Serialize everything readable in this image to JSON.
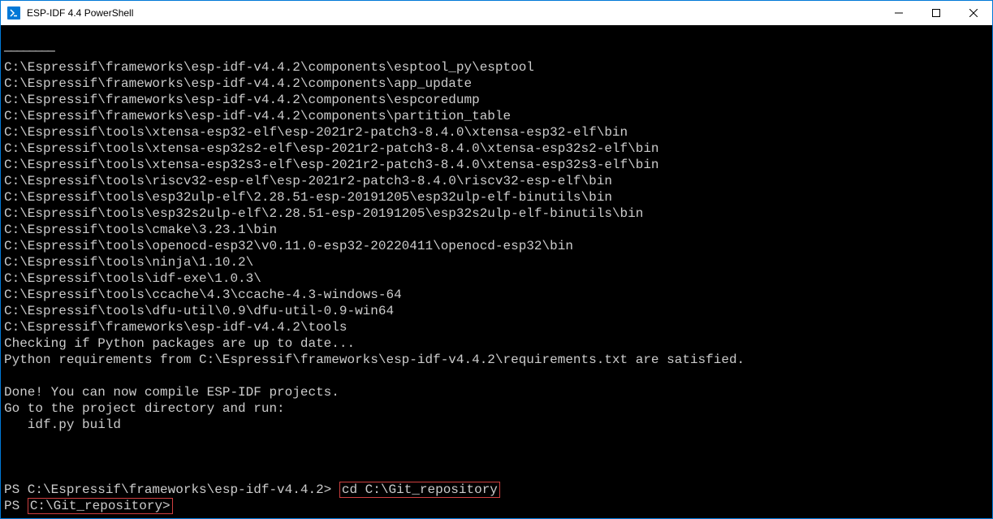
{
  "window": {
    "title": "ESP-IDF 4.4 PowerShell"
  },
  "terminal": {
    "separator": "————————",
    "paths": [
      "C:\\Espressif\\frameworks\\esp-idf-v4.4.2\\components\\esptool_py\\esptool",
      "C:\\Espressif\\frameworks\\esp-idf-v4.4.2\\components\\app_update",
      "C:\\Espressif\\frameworks\\esp-idf-v4.4.2\\components\\espcoredump",
      "C:\\Espressif\\frameworks\\esp-idf-v4.4.2\\components\\partition_table",
      "C:\\Espressif\\tools\\xtensa-esp32-elf\\esp-2021r2-patch3-8.4.0\\xtensa-esp32-elf\\bin",
      "C:\\Espressif\\tools\\xtensa-esp32s2-elf\\esp-2021r2-patch3-8.4.0\\xtensa-esp32s2-elf\\bin",
      "C:\\Espressif\\tools\\xtensa-esp32s3-elf\\esp-2021r2-patch3-8.4.0\\xtensa-esp32s3-elf\\bin",
      "C:\\Espressif\\tools\\riscv32-esp-elf\\esp-2021r2-patch3-8.4.0\\riscv32-esp-elf\\bin",
      "C:\\Espressif\\tools\\esp32ulp-elf\\2.28.51-esp-20191205\\esp32ulp-elf-binutils\\bin",
      "C:\\Espressif\\tools\\esp32s2ulp-elf\\2.28.51-esp-20191205\\esp32s2ulp-elf-binutils\\bin",
      "C:\\Espressif\\tools\\cmake\\3.23.1\\bin",
      "C:\\Espressif\\tools\\openocd-esp32\\v0.11.0-esp32-20220411\\openocd-esp32\\bin",
      "C:\\Espressif\\tools\\ninja\\1.10.2\\",
      "C:\\Espressif\\tools\\idf-exe\\1.0.3\\",
      "C:\\Espressif\\tools\\ccache\\4.3\\ccache-4.3-windows-64",
      "C:\\Espressif\\tools\\dfu-util\\0.9\\dfu-util-0.9-win64",
      "C:\\Espressif\\frameworks\\esp-idf-v4.4.2\\tools"
    ],
    "check_line": "Checking if Python packages are up to date...",
    "req_line": "Python requirements from C:\\Espressif\\frameworks\\esp-idf-v4.4.2\\requirements.txt are satisfied.",
    "done_line": "Done! You can now compile ESP-IDF projects.",
    "goto_line": "Go to the project directory and run:",
    "build_line": "   idf.py build",
    "prompt1_prefix": "PS C:\\Espressif\\frameworks\\esp-idf-v4.4.2> ",
    "prompt1_cmd": "cd C:\\Git_repository",
    "prompt2_prefix": "PS ",
    "prompt2_path": "C:\\Git_repository>"
  }
}
